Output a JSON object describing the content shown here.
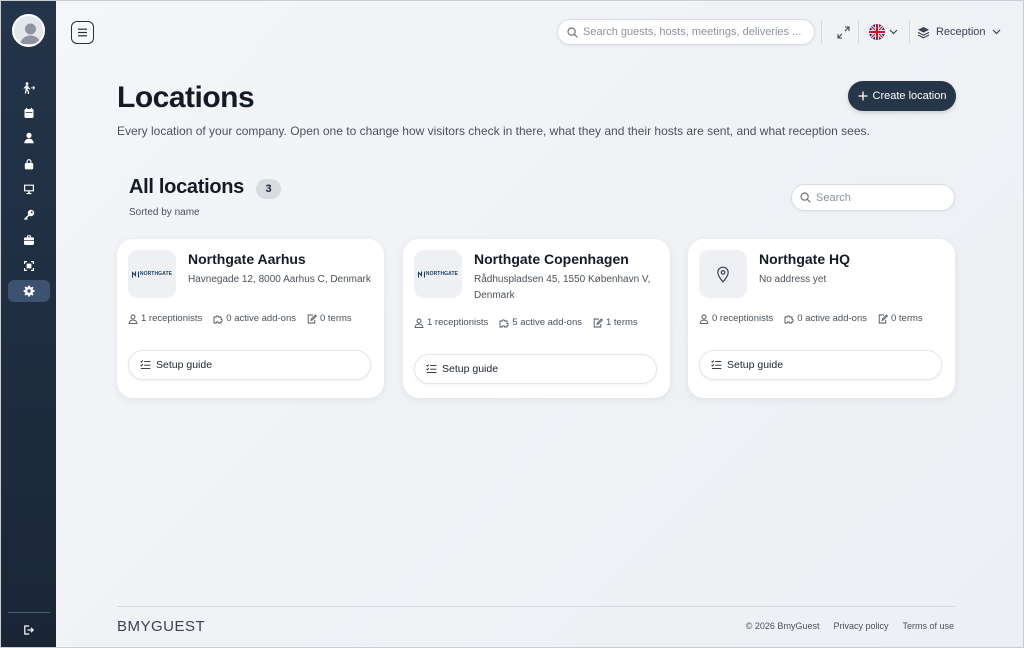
{
  "sidebar": {
    "items": [
      {
        "icon": "check-in-icon"
      },
      {
        "icon": "calendar-icon"
      },
      {
        "icon": "user-icon"
      },
      {
        "icon": "lock-icon"
      },
      {
        "icon": "monitor-icon"
      },
      {
        "icon": "key-icon"
      },
      {
        "icon": "briefcase-icon"
      },
      {
        "icon": "scan-icon"
      },
      {
        "icon": "gear-icon",
        "active": true
      }
    ],
    "logout_icon": "logout-icon"
  },
  "topbar": {
    "search_placeholder": "Search guests, hosts, meetings, deliveries ...",
    "language": "en-GB",
    "workspace_label": "Reception"
  },
  "page": {
    "title": "Locations",
    "description": "Every location of your company. Open one to change how visitors check in there, what they and their hosts are sent, and what reception sees.",
    "create_button": "Create location"
  },
  "list": {
    "title": "All locations",
    "count": "3",
    "sort_label": "Sorted by name",
    "search_placeholder": "Search"
  },
  "locations": [
    {
      "name": "Northgate Aarhus",
      "address": "Havnegade 12, 8000 Aarhus C, Denmark",
      "logo_text": "NORTHGATE",
      "receptionists": "1 receptionists",
      "addons": "0 active add-ons",
      "terms": "0 terms",
      "setup_label": "Setup guide"
    },
    {
      "name": "Northgate Copenhagen",
      "address": "Rådhuspladsen 45, 1550 København V, Denmark",
      "logo_text": "NORTHGATE",
      "receptionists": "1 receptionists",
      "addons": "5 active add-ons",
      "terms": "1 terms",
      "setup_label": "Setup guide"
    },
    {
      "name": "Northgate HQ",
      "address": "No address yet",
      "logo_text": "",
      "receptionists": "0 receptionists",
      "addons": "0 active add-ons",
      "terms": "0 terms",
      "setup_label": "Setup guide"
    }
  ],
  "footer": {
    "logo": "BMYGUEST",
    "copyright": "© 2026 BmyGuest",
    "privacy": "Privacy policy",
    "terms": "Terms of use"
  },
  "colors": {
    "sidebar": "#1f2d40",
    "accent": "#273548",
    "background": "#eef1f4"
  }
}
